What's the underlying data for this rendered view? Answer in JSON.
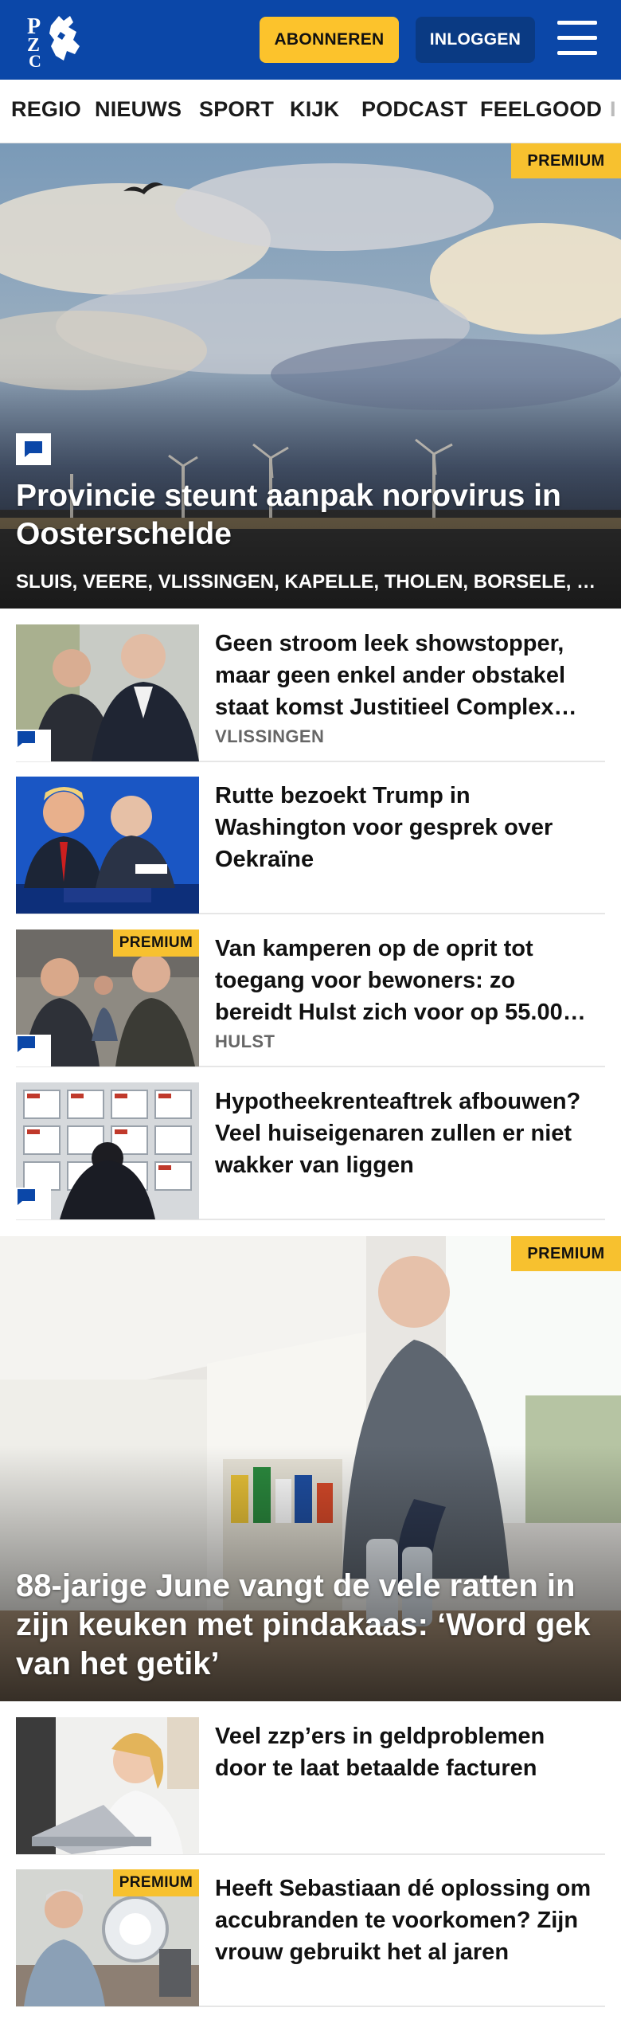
{
  "header": {
    "logo_text": "PZC",
    "subscribe_label": "ABONNEREN",
    "login_label": "INLOGGEN",
    "menu_icon": "hamburger-icon",
    "brand_color": "#0b47a8",
    "accent_color": "#fcc32c"
  },
  "nav": {
    "items": [
      "REGIO",
      "NIEUWS",
      "SPORT",
      "KIJK",
      "PODCAST",
      "FEELGOOD",
      "I"
    ]
  },
  "hero1": {
    "badge": "PREMIUM",
    "title": "Provincie steunt aanpak norovirus in Oosterschelde",
    "tags": "SLUIS, VEERE, VLISSINGEN, KAPELLE, THOLEN, BORSELE, …",
    "has_comments": true
  },
  "articles": [
    {
      "title": "Geen stroom leek showstopper, maar geen enkel ander obstakel staat komst Justitieel Complex…",
      "location": "VLISSINGEN",
      "premium": false,
      "comments": true
    },
    {
      "title": "Rutte bezoekt Trump in Washington voor gesprek over Oekraïne",
      "location": "",
      "premium": false,
      "comments": false
    },
    {
      "title": "Van kamperen op de oprit tot toegang voor bewoners: zo bereidt Hulst zich voor op 55.00…",
      "location": "HULST",
      "premium": true,
      "comments": true
    },
    {
      "title": "Hypotheekrenteaftrek afbouwen? Veel huiseigenaren zullen er niet wakker van liggen",
      "location": "",
      "premium": false,
      "comments": true
    }
  ],
  "hero2": {
    "badge": "PREMIUM",
    "title": "88-jarige June vangt de vele ratten in zijn keuken met pindakaas: ‘Word gek van het getik’"
  },
  "articles2": [
    {
      "title": "Veel zzp’ers in geldproblemen door te laat betaalde facturen",
      "location": "",
      "premium": false,
      "comments": false
    },
    {
      "title": "Heeft Sebastiaan dé oplossing om accubranden te voorkomen? Zijn vrouw gebruikt het al jaren",
      "location": "",
      "premium": true,
      "premium_label": "PREMIUM",
      "comments": false
    }
  ],
  "premium_label": "PREMIUM"
}
